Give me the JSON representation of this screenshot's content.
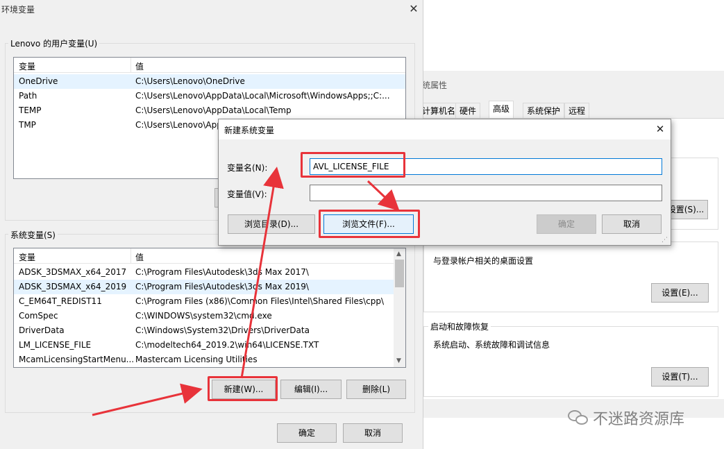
{
  "env_window": {
    "title": "环境变量",
    "user_group_title": "Lenovo 的用户变量(U)",
    "sys_group_title": "系统变量(S)",
    "col_var": "变量",
    "col_val": "值",
    "user_vars": [
      {
        "name": "OneDrive",
        "value": "C:\\Users\\Lenovo\\OneDrive"
      },
      {
        "name": "Path",
        "value": "C:\\Users\\Lenovo\\AppData\\Local\\Microsoft\\WindowsApps;;C:..."
      },
      {
        "name": "TEMP",
        "value": "C:\\Users\\Lenovo\\AppData\\Local\\Temp"
      },
      {
        "name": "TMP",
        "value": "C:\\Users\\Lenovo\\App"
      }
    ],
    "sys_vars": [
      {
        "name": "ADSK_3DSMAX_x64_2017",
        "value": "C:\\Program Files\\Autodesk\\3ds Max 2017\\"
      },
      {
        "name": "ADSK_3DSMAX_x64_2019",
        "value": "C:\\Program Files\\Autodesk\\3ds Max 2019\\"
      },
      {
        "name": "C_EM64T_REDIST11",
        "value": "C:\\Program Files (x86)\\Common Files\\Intel\\Shared Files\\cpp\\"
      },
      {
        "name": "ComSpec",
        "value": "C:\\WINDOWS\\system32\\cmd.exe"
      },
      {
        "name": "DriverData",
        "value": "C:\\Windows\\System32\\Drivers\\DriverData"
      },
      {
        "name": "LM_LICENSE_FILE",
        "value": "C:\\modeltech64_2019.2\\win64\\LICENSE.TXT"
      },
      {
        "name": "McamLicensingStartMenu...",
        "value": "Mastercam Licensing Utilities"
      }
    ],
    "new_btn": "新建(W)...",
    "edit_btn": "编辑(I)...",
    "delete_btn": "删除(L)",
    "ok_btn": "确定",
    "cancel_btn": "取消"
  },
  "sys_props": {
    "title": "统属性",
    "tabs": [
      "计算机名",
      "硬件",
      "高级",
      "系统保护",
      "远程"
    ],
    "active_tab": "高级",
    "profile_desc": "与登录帐户相关的桌面设置",
    "profile_btn": "设置(E)...",
    "perf_btn": "设置(S)...",
    "startup_title": "启动和故障恢复",
    "startup_desc": "系统启动、系统故障和调试信息",
    "startup_btn": "设置(T)..."
  },
  "new_var_dialog": {
    "title": "新建系统变量",
    "name_label": "变量名(N):",
    "value_label": "变量值(V):",
    "name_value": "AVL_LICENSE_FILE",
    "value_value": "",
    "browse_dir_btn": "浏览目录(D)...",
    "browse_file_btn": "浏览文件(F)...",
    "ok_btn": "确定",
    "cancel_btn": "取消"
  },
  "watermark": {
    "text": "不迷路资源库"
  },
  "colors": {
    "highlight_red": "#e8333a",
    "selection": "#e5f3ff",
    "accent": "#0078d7"
  }
}
